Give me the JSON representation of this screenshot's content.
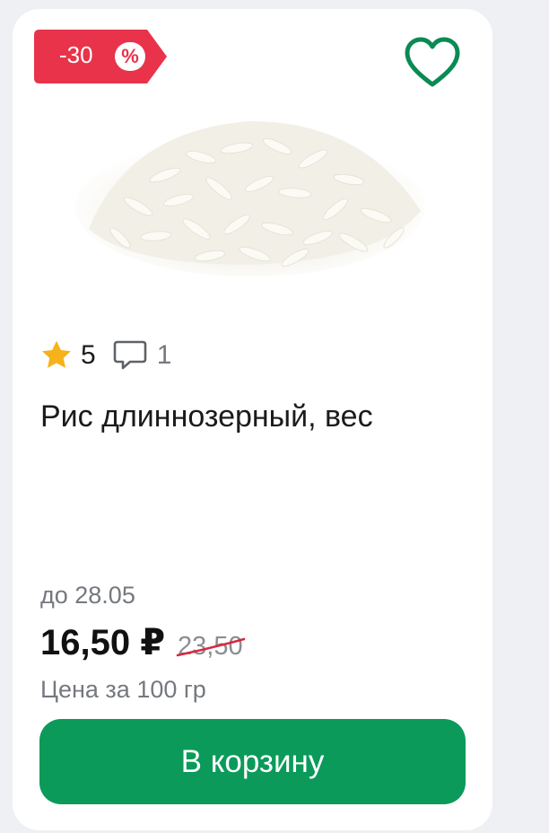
{
  "badge": {
    "discount_label": "-30",
    "percent_symbol": "%",
    "color": "#e8334a"
  },
  "favorite": {
    "icon": "heart-outline-icon",
    "color": "#0b8a53"
  },
  "product": {
    "image": "rice-image",
    "rating": "5",
    "comments": "1",
    "title": "Рис длиннозерный, вес"
  },
  "pricing": {
    "valid_until": "до 28.05",
    "current_price": "16,50 ₽",
    "old_price": "23,50",
    "unit_note": "Цена за 100 гр"
  },
  "cart": {
    "label": "В корзину",
    "color": "#0b9a5a"
  }
}
